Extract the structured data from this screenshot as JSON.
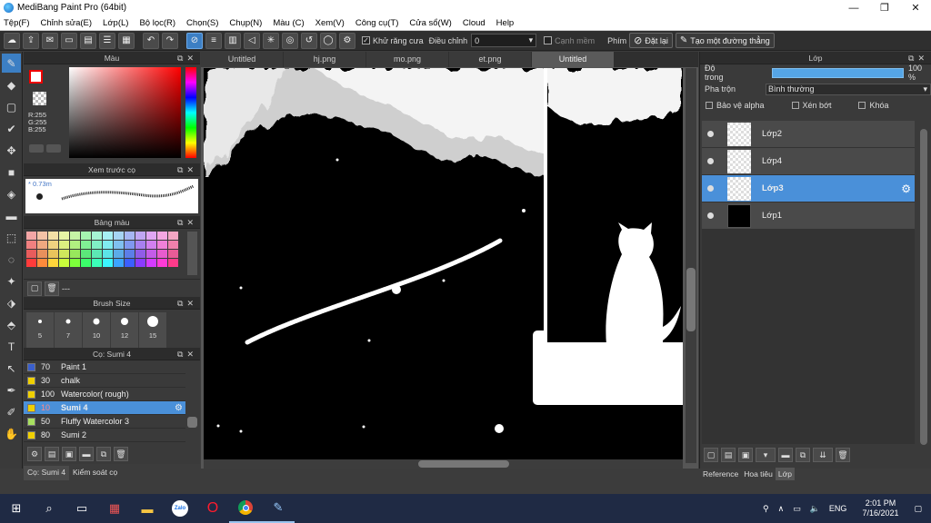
{
  "window": {
    "title": "MediBang Paint Pro (64bit)",
    "controls": [
      "—",
      "❐",
      "✕"
    ]
  },
  "menu": [
    "Tệp(F)",
    "Chỉnh sửa(E)",
    "Lớp(L)",
    "Bộ lọc(R)",
    "Chọn(S)",
    "Chụp(N)",
    "Màu (C)",
    "Xem(V)",
    "Công cụ(T)",
    "Cửa sổ(W)",
    "Cloud",
    "Help"
  ],
  "toolbar": {
    "antialias_label": "Khử răng cưa",
    "adjust_label": "Điều chỉnh",
    "adjust_value": "0",
    "edge_label": "Cạnh mềm",
    "key_label": "Phím",
    "reset_label": "Đặt lại",
    "straight_line_label": "Tạo một đường thẳng"
  },
  "color_panel": {
    "title": "Màu",
    "rgb_text": "R:255\nG:255\nB:255\n#FFFFFF"
  },
  "preview_panel": {
    "title": "Xem trước cọ",
    "size_label": "0.73m"
  },
  "palette_panel": {
    "title": "Bảng màu",
    "colors": [
      "#f4a6a6",
      "#f4c2a6",
      "#f4e0a6",
      "#e7f4a6",
      "#c6f4a6",
      "#a6f4b0",
      "#a6f4d4",
      "#a6f0f4",
      "#a6d4f4",
      "#a6b6f4",
      "#c0a6f4",
      "#e0a6f4",
      "#f4a6e2",
      "#f4a6c4",
      "#f08080",
      "#f0a880",
      "#f0d280",
      "#dcf080",
      "#b0f080",
      "#80f094",
      "#80f0c4",
      "#80ecf0",
      "#80c0f0",
      "#8098f0",
      "#a880f0",
      "#d280f0",
      "#f080d8",
      "#f080ac",
      "#e85c5c",
      "#e8905c",
      "#e8c45c",
      "#d0e85c",
      "#98e85c",
      "#5ce87a",
      "#5ce8b4",
      "#5ce4e8",
      "#5cace8",
      "#5c7ee8",
      "#905ce8",
      "#c45ce8",
      "#e85cce",
      "#e85c96",
      "#ff3b3b",
      "#ff8a3b",
      "#ffd43b",
      "#c9ff3b",
      "#7dff3b",
      "#3bff6a",
      "#3bffb8",
      "#3bf6ff",
      "#3ba4ff",
      "#3b5fff",
      "#8a3bff",
      "#d43bff",
      "#ff3bd7",
      "#ff3b8a"
    ],
    "footer_label": "---"
  },
  "brush_size_panel": {
    "title": "Brush Size",
    "sizes": [
      5,
      7,
      10,
      12,
      15
    ],
    "dots": [
      4,
      5,
      7,
      8,
      12
    ]
  },
  "brush_panel": {
    "title": "Cọ: Sumi 4",
    "items": [
      {
        "size": "70",
        "name": "Paint 1",
        "color": "#3a5fcd"
      },
      {
        "size": "30",
        "name": "chalk",
        "color": "#f0d000"
      },
      {
        "size": "100",
        "name": "Watercolor( rough)",
        "color": "#f0d000"
      },
      {
        "size": "10",
        "name": "Sumi 4",
        "color": "#f0d000",
        "selected": true
      },
      {
        "size": "50",
        "name": "Fluffy Watercolor 3",
        "color": "#a8e060"
      },
      {
        "size": "80",
        "name": "Sumi 2",
        "color": "#f0d000"
      }
    ]
  },
  "left_footer": {
    "brush_tab": "Cọ: Sumi 4",
    "control_tab": "Kiểm soát cọ"
  },
  "tabs": [
    "Untitled",
    "hj.png",
    "mo.png",
    "et.png",
    "Untitled"
  ],
  "active_tab": 4,
  "layer_panel": {
    "title": "Lớp",
    "opacity_label": "Độ trong",
    "opacity_value": "100 %",
    "blend_label": "Pha trộn",
    "blend_value": "Bình thường",
    "protect_alpha": "Bảo vệ alpha",
    "clipping": "Xén bớt",
    "lock": "Khóa",
    "layers": [
      {
        "name": "Lớp2",
        "thumb": "checker"
      },
      {
        "name": "Lớp4",
        "thumb": "checker"
      },
      {
        "name": "Lớp3",
        "thumb": "checker",
        "selected": true
      },
      {
        "name": "Lớp1",
        "thumb": "black"
      }
    ]
  },
  "right_tabs": [
    "Reference",
    "Hoa tiêu",
    "Lớp"
  ],
  "taskbar": {
    "apps": [
      "windows-start-icon",
      "search-icon",
      "task-view-icon",
      "file-explorer-icon",
      "zalo-icon",
      "opera-icon",
      "chrome-icon",
      "medibang-icon"
    ],
    "tray_lang": "ENG",
    "time": "2:01 PM",
    "date": "7/16/2021"
  }
}
